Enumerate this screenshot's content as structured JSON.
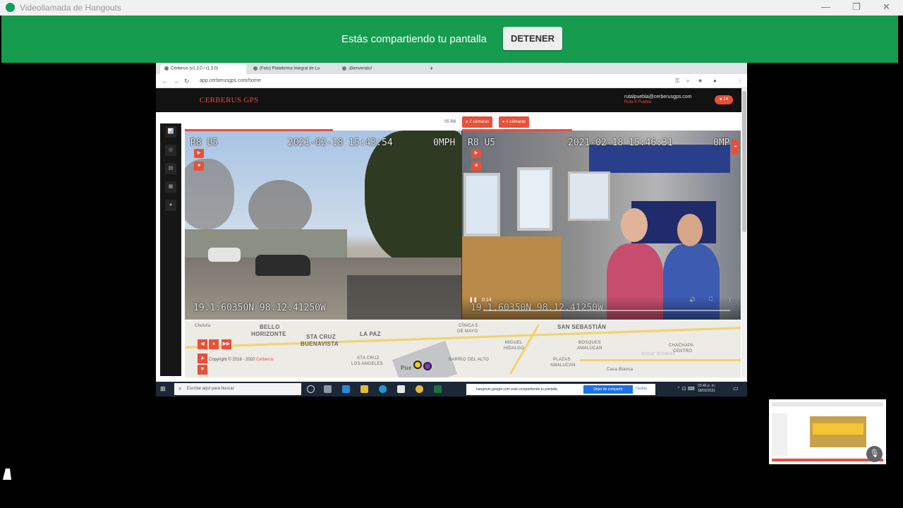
{
  "hangouts": {
    "window_title": "Videollamada de Hangouts",
    "share_message": "Estás compartiendo tu pantalla",
    "stop_button": "DETENER",
    "minimize": "—",
    "restore": "❐",
    "close": "✕"
  },
  "browser": {
    "tabs": [
      {
        "label": "Cerberus (v1.3.0 / r1.3.0)"
      },
      {
        "label": "(Foto) Plataforma Integral de Lo"
      },
      {
        "label": "¡Bienvenido!"
      }
    ],
    "new_tab": "+",
    "url": "app.cerberusgps.com/home"
  },
  "app": {
    "brand": "CERBERUS GPS",
    "user_email": "rutalpuebla@cerberusgps.com",
    "user_role": "Ruta 8 Puebla",
    "user_badge": "● 14",
    "device_label": "05 R8",
    "camera_tabs": [
      "● 2 cámaras",
      "● 4 cámaras"
    ],
    "sidebar_icons": [
      "📊",
      "◎",
      "▤",
      "▦",
      "●"
    ]
  },
  "cameras": {
    "left": {
      "unit": "R8 U5",
      "timestamp": "2021-02-18 15:43:54",
      "speed": "0MPH",
      "coords": "19.1.60350N 98.12.41250W",
      "play": "▶",
      "stop": "■"
    },
    "right": {
      "unit": "R8 U5",
      "timestamp": "2021-02-18 15:46:31",
      "speed": "0MP",
      "coords": "19.1.60350N 98.12.41250W",
      "time": "0:14",
      "play": "▶",
      "stop": "■",
      "pause": "❚❚",
      "volume": "🔊",
      "fullscreen": "⛶",
      "more": "⋮"
    }
  },
  "map": {
    "labels": [
      {
        "text": "Cholula",
        "cls": "sm"
      },
      {
        "text": "BELLO",
        "cls": ""
      },
      {
        "text": "HORIZONTE",
        "cls": ""
      },
      {
        "text": "STA CRUZ",
        "cls": ""
      },
      {
        "text": "BUENAVISTA",
        "cls": ""
      },
      {
        "text": "LA PAZ",
        "cls": ""
      },
      {
        "text": "SAN SEBASTIÁN",
        "cls": ""
      },
      {
        "text": "CÍNICA 5",
        "cls": "sm"
      },
      {
        "text": "DE MAYO",
        "cls": "sm"
      },
      {
        "text": "MIGUEL",
        "cls": "sm"
      },
      {
        "text": "HIDALGO",
        "cls": "sm"
      },
      {
        "text": "BOSQUES",
        "cls": "sm"
      },
      {
        "text": "AMALUCAN",
        "cls": "sm"
      },
      {
        "text": "CHACHAPA",
        "cls": "sm"
      },
      {
        "text": "CENTRO",
        "cls": "sm"
      },
      {
        "text": "PLAZAS",
        "cls": "sm"
      },
      {
        "text": "AMALUCAN",
        "cls": "sm"
      },
      {
        "text": "Casa Blanca",
        "cls": "sm"
      },
      {
        "text": "STA CRUZ",
        "cls": "sm"
      },
      {
        "text": "LOS ANGELES",
        "cls": "sm"
      },
      {
        "text": "BARRIO DEL ALTO",
        "cls": "sm"
      },
      {
        "text": "Pue",
        "cls": ""
      },
      {
        "text": "Activar Windows",
        "cls": "sm"
      }
    ],
    "copyright": "Copyright © 2016 - 2020",
    "copyright_link": "Cerberus",
    "btn_back": "◀",
    "btn_stop": "●",
    "btn_next": "▶▶",
    "btn_up": "▲",
    "btn_down": "▼"
  },
  "taskbar": {
    "start": "⊞",
    "search": "Escribe aquí para buscar",
    "notice_text": "hangouts.google.com está compartiendo tu pantalla.",
    "notice_stop": "Dejar de compartir",
    "notice_hide": "Ocultar",
    "time": "03:46 p. m.",
    "date": "18/02/2021"
  },
  "selfview": {
    "mic_icon": "🎙"
  },
  "colors": {
    "hangouts_green": "#159c4e",
    "accent_red": "#e8503a"
  }
}
